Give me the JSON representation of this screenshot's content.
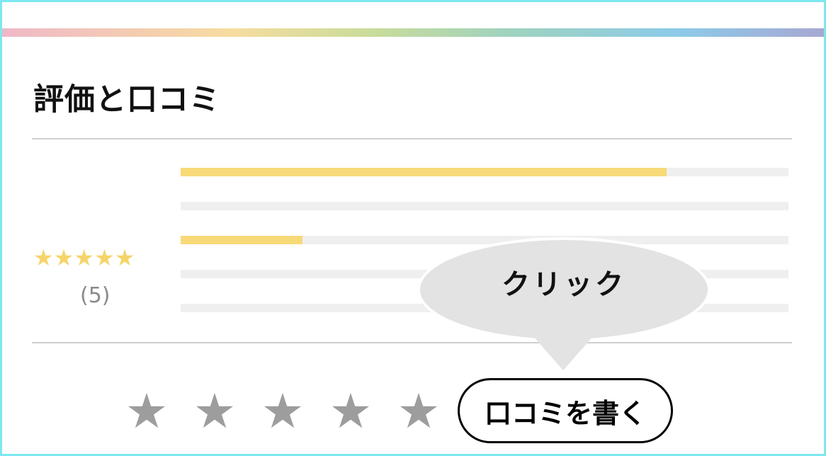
{
  "section": {
    "title": "評価と口コミ"
  },
  "summary": {
    "average_stars": "★★★★★",
    "count": "(5)"
  },
  "rating_bars": [
    {
      "fraction": 0.8
    },
    {
      "fraction": 0.0
    },
    {
      "fraction": 0.2
    },
    {
      "fraction": 0.0
    },
    {
      "fraction": 0.0
    }
  ],
  "rate_input": {
    "stars": [
      "★",
      "★",
      "★",
      "★",
      "★"
    ]
  },
  "write_review": {
    "label": "口コミを書く"
  },
  "tooltip": {
    "text": "クリック"
  },
  "colors": {
    "star_fill": "#f5d56a",
    "bar_fill": "#f7d978",
    "star_empty": "#9d9d9d",
    "frame": "#7ee8ef"
  }
}
